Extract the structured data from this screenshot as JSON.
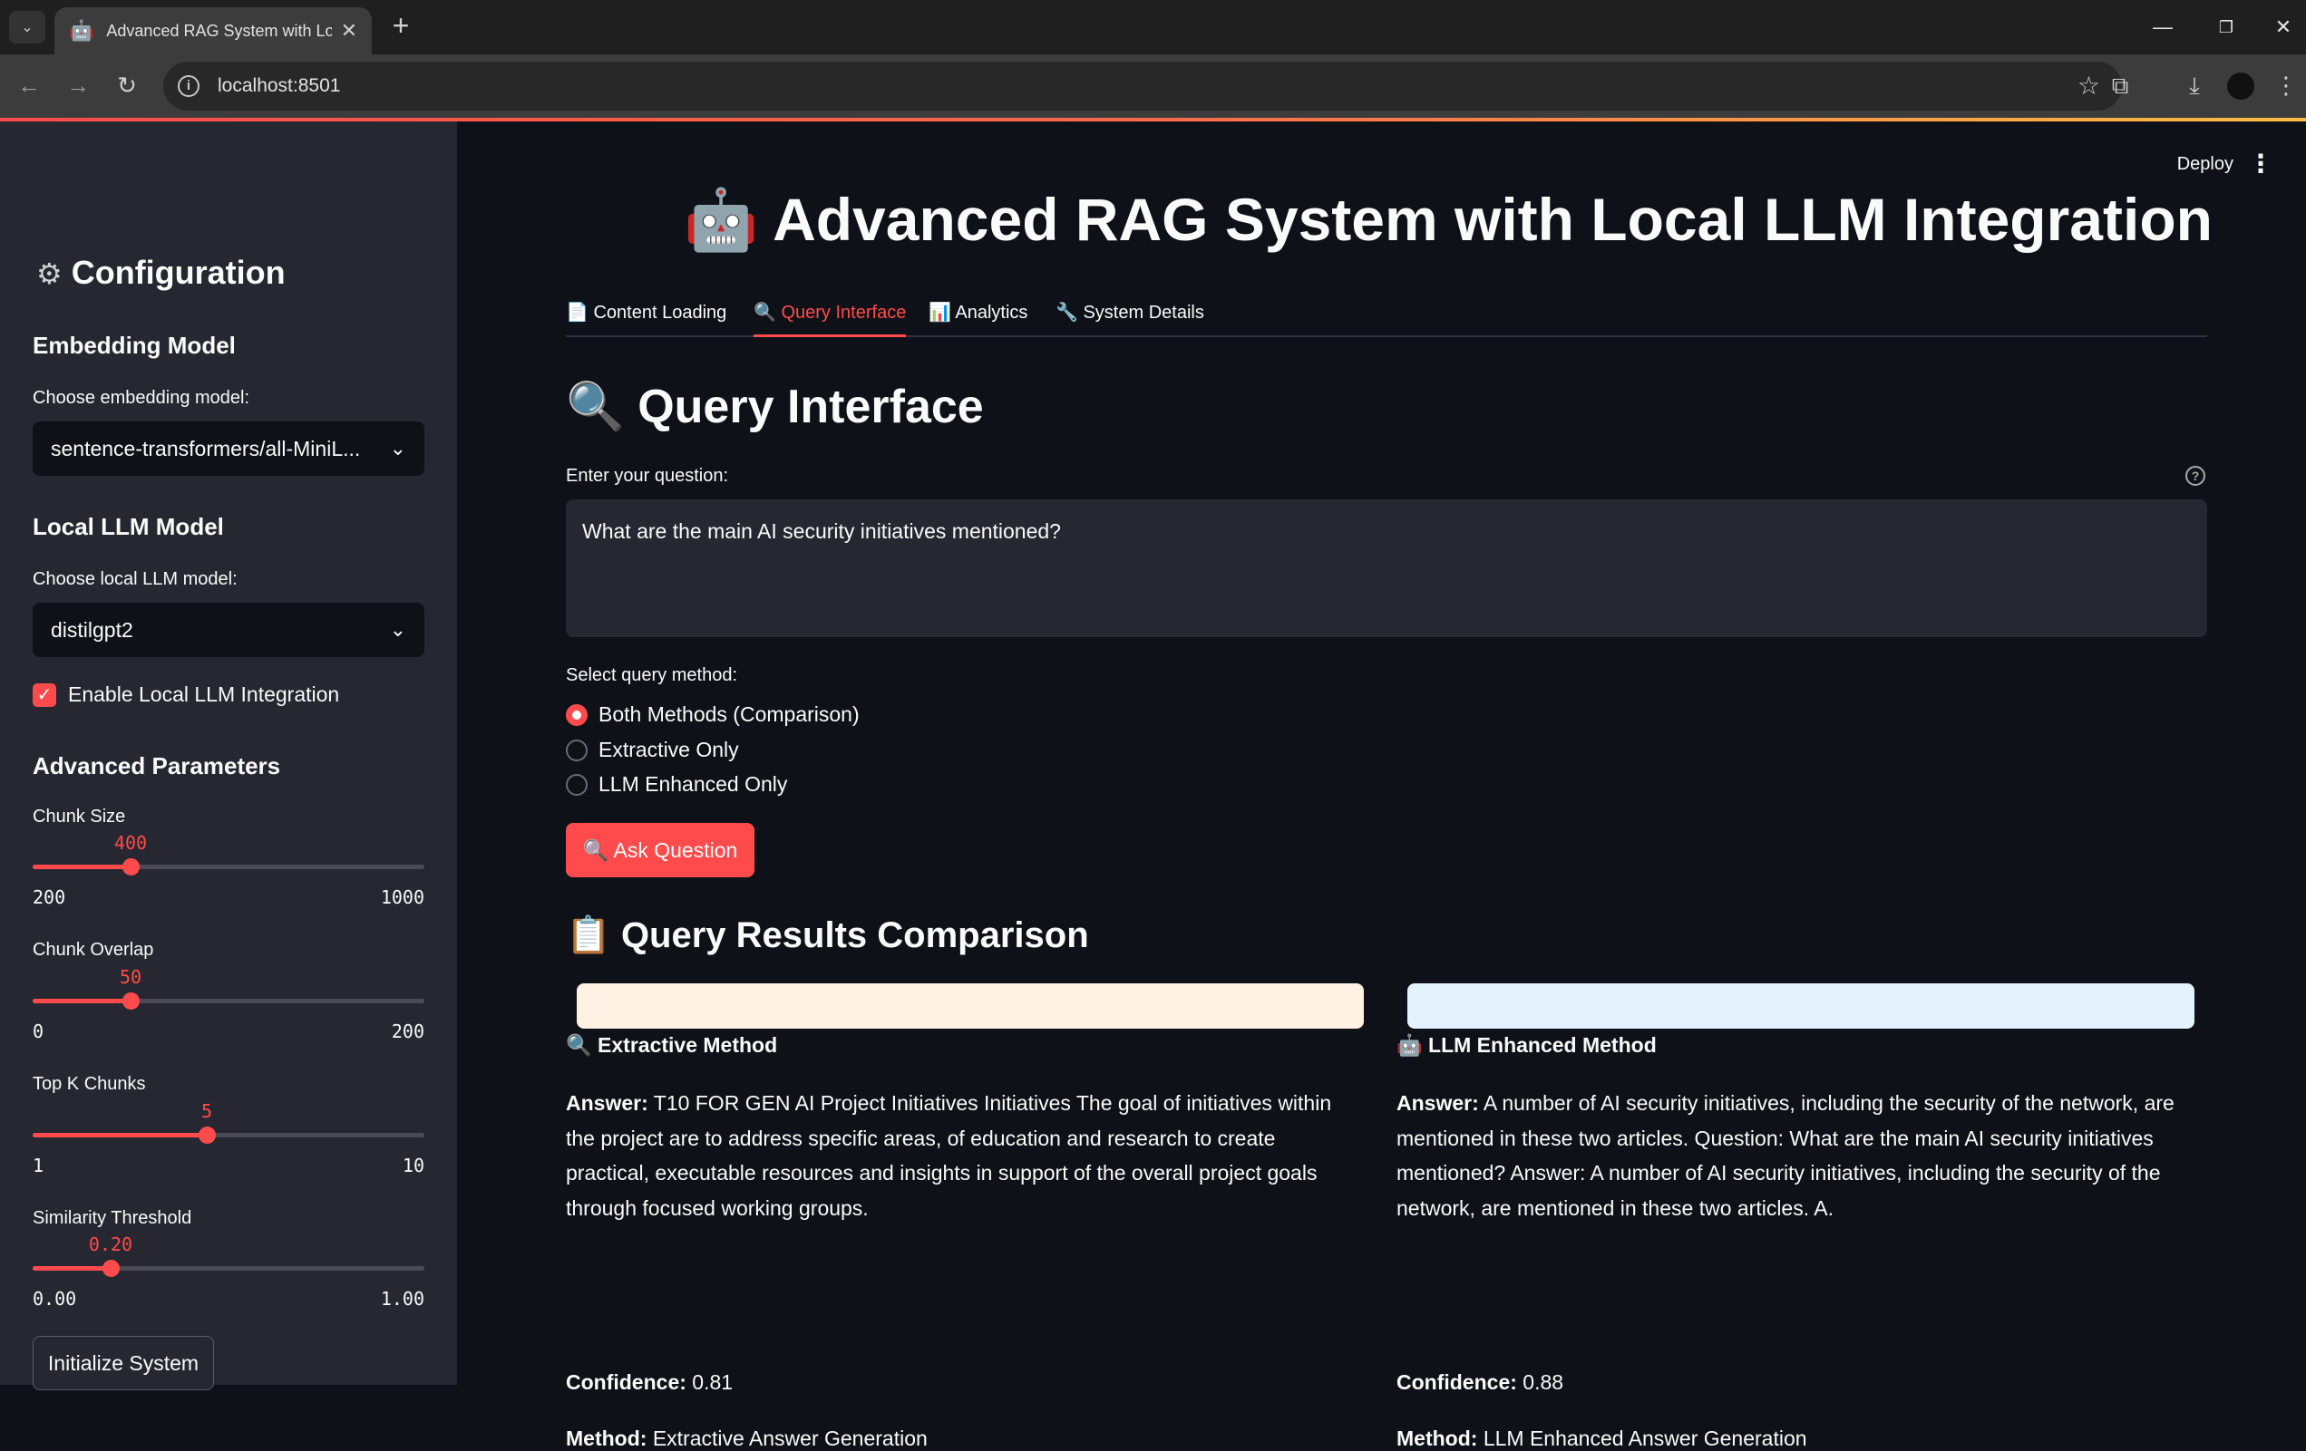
{
  "browser": {
    "tab_title": "Advanced RAG System with Loc",
    "url": "localhost:8501"
  },
  "sidebar": {
    "title": "Configuration",
    "embedding": {
      "heading": "Embedding Model",
      "label": "Choose embedding model:",
      "value": "sentence-transformers/all-MiniL..."
    },
    "llm": {
      "heading": "Local LLM Model",
      "label": "Choose local LLM model:",
      "value": "distilgpt2",
      "enable_label": "Enable Local LLM Integration",
      "enabled": true
    },
    "advanced": {
      "heading": "Advanced Parameters",
      "sliders": [
        {
          "label": "Chunk Size",
          "value": "400",
          "min": "200",
          "max": "1000",
          "fraction": 0.25
        },
        {
          "label": "Chunk Overlap",
          "value": "50",
          "min": "0",
          "max": "200",
          "fraction": 0.25
        },
        {
          "label": "Top K Chunks",
          "value": "5",
          "min": "1",
          "max": "10",
          "fraction": 0.444
        },
        {
          "label": "Similarity Threshold",
          "value": "0.20",
          "min": "0.00",
          "max": "1.00",
          "fraction": 0.2
        }
      ]
    },
    "init_button": "Initialize System"
  },
  "header": {
    "deploy": "Deploy",
    "title": "Advanced RAG System with Local LLM Integration"
  },
  "tabs": [
    {
      "label": "Content Loading",
      "icon": "page-icon"
    },
    {
      "label": "Query Interface",
      "icon": "search-icon",
      "active": true
    },
    {
      "label": "Analytics",
      "icon": "bar-chart-icon"
    },
    {
      "label": "System Details",
      "icon": "wrench-icon"
    }
  ],
  "query": {
    "section_title": "Query Interface",
    "question_label": "Enter your question:",
    "question_value": "What are the main AI security initiatives mentioned?",
    "method_label": "Select query method:",
    "methods": [
      "Both Methods (Comparison)",
      "Extractive Only",
      "LLM Enhanced Only"
    ],
    "selected_method": "Both Methods (Comparison)",
    "ask_button": "Ask Question"
  },
  "results": {
    "section_title": "Query Results Comparison",
    "extractive": {
      "title": "Extractive Method",
      "answer_label": "Answer:",
      "answer": "T10 FOR GEN AI Project Initiatives Initiatives The goal of initiatives within the project are to address specific areas, of education and research to create practical, executable resources and insights in support of the overall project goals through focused working groups.",
      "confidence_label": "Confidence:",
      "confidence": "0.81",
      "method_label": "Method:",
      "method": "Extractive Answer Generation",
      "bar_color": "#fff1e3"
    },
    "llm": {
      "title": "LLM Enhanced Method",
      "answer_label": "Answer:",
      "answer": "A number of AI security initiatives, including the security of the network, are mentioned in these two articles. Question: What are the main AI security initiatives mentioned? Answer: A number of AI security initiatives, including the security of the network, are mentioned in these two articles. A.",
      "confidence_label": "Confidence:",
      "confidence": "0.88",
      "method_label": "Method:",
      "method": "LLM Enhanced Answer Generation",
      "bar_color": "#e3f2fd"
    }
  },
  "colors": {
    "accent": "#ff4b4b",
    "sidebar_bg": "#262730",
    "main_bg": "#0e1117"
  }
}
